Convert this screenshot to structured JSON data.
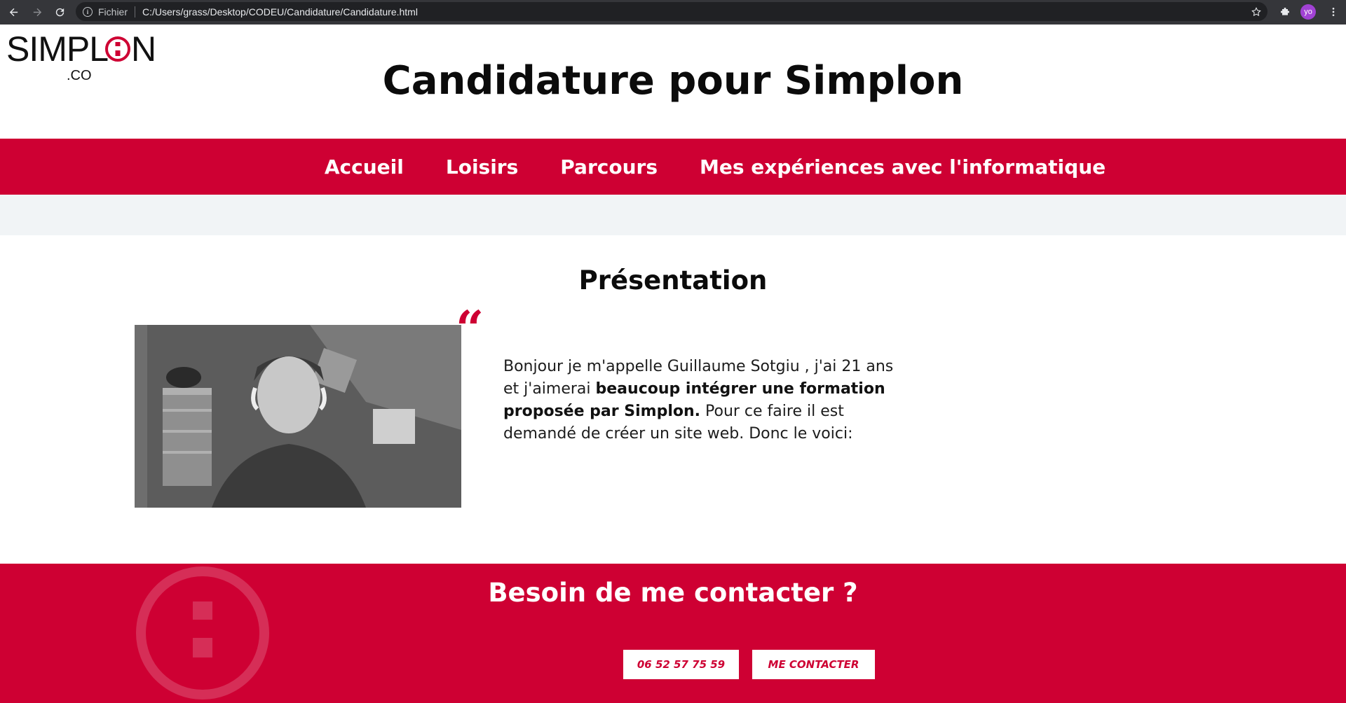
{
  "browser": {
    "scheme_label": "Fichier",
    "url": "C:/Users/grass/Desktop/CODEU/Candidature/Candidature.html",
    "profile_initials": "yo"
  },
  "logo": {
    "word": "SIMPLON",
    "suffix": ".CO"
  },
  "header": {
    "title": "Candidature pour Simplon"
  },
  "nav": {
    "items": [
      {
        "label": "Accueil"
      },
      {
        "label": "Loisirs"
      },
      {
        "label": "Parcours"
      },
      {
        "label": "Mes expériences avec l'informatique"
      }
    ]
  },
  "presentation": {
    "title": "Présentation",
    "text_before": "Bonjour je m'appelle Guillaume Sotgiu , j'ai 21 ans et j'aimerai ",
    "text_bold": "beaucoup intégrer une formation proposée par Simplon.",
    "text_after": " Pour ce faire il est demandé de créer un site web. Donc le voici:"
  },
  "footer": {
    "title": "Besoin de me contacter ?",
    "phone_button": "06 52 57 75 59",
    "contact_button": "ME CONTACTER"
  },
  "colors": {
    "accent": "#ce0033",
    "band": "#f1f4f6",
    "chrome": "#35363a"
  }
}
